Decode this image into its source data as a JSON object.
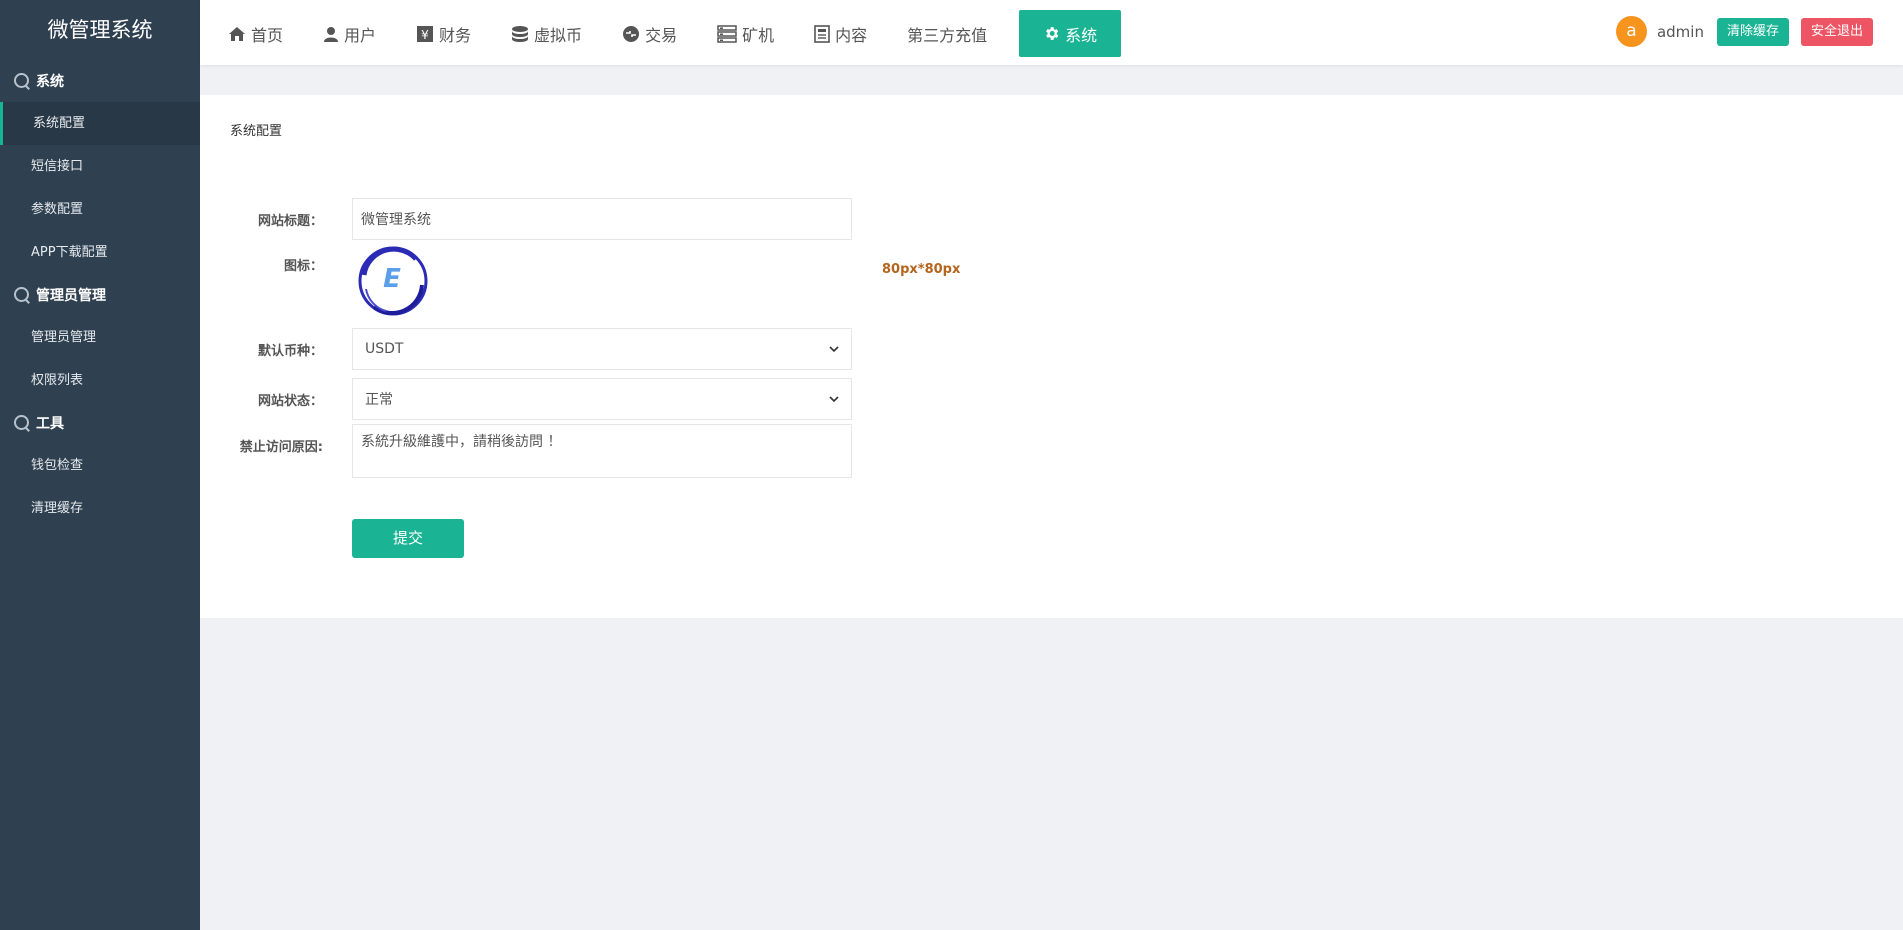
{
  "sidebar": {
    "brand": "微管理系统",
    "groups": [
      {
        "title": "系统",
        "items": [
          "系统配置",
          "短信接口",
          "参数配置",
          "APP下载配置"
        ]
      },
      {
        "title": "管理员管理",
        "items": [
          "管理员管理",
          "权限列表"
        ]
      },
      {
        "title": "工具",
        "items": [
          "钱包检查",
          "清理缓存"
        ]
      }
    ],
    "active_item": "系统配置"
  },
  "topnav": {
    "items": [
      {
        "label": "首页",
        "icon": "home-icon"
      },
      {
        "label": "用户",
        "icon": "user-icon"
      },
      {
        "label": "财务",
        "icon": "yen-icon"
      },
      {
        "label": "虚拟币",
        "icon": "database-icon"
      },
      {
        "label": "交易",
        "icon": "exchange-icon"
      },
      {
        "label": "矿机",
        "icon": "server-icon"
      },
      {
        "label": "内容",
        "icon": "document-icon"
      },
      {
        "label": "第三方充值",
        "icon": ""
      },
      {
        "label": "系统",
        "icon": "gear-icon",
        "active": true
      }
    ]
  },
  "user": {
    "avatar_letter": "a",
    "name": "admin",
    "clear_cache": "清除缓存",
    "logout": "安全退出"
  },
  "panel": {
    "title": "系统配置",
    "site_title_label": "网站标题：",
    "site_title_value": "微管理系统",
    "icon_label": "图标：",
    "icon_hint": "80px*80px",
    "currency_label": "默认币种：",
    "currency_value": "USDT",
    "status_label": "网站状态：",
    "status_value": "正常",
    "reason_label": "禁止访问原因:",
    "reason_value": "系統升級維護中，請稍後訪問 ！",
    "submit": "提交"
  },
  "colors": {
    "sidebar_bg": "#2f4050",
    "accent": "#1ab394",
    "danger": "#ed5565",
    "avatar": "#f7941d",
    "hint": "#b5651d"
  }
}
